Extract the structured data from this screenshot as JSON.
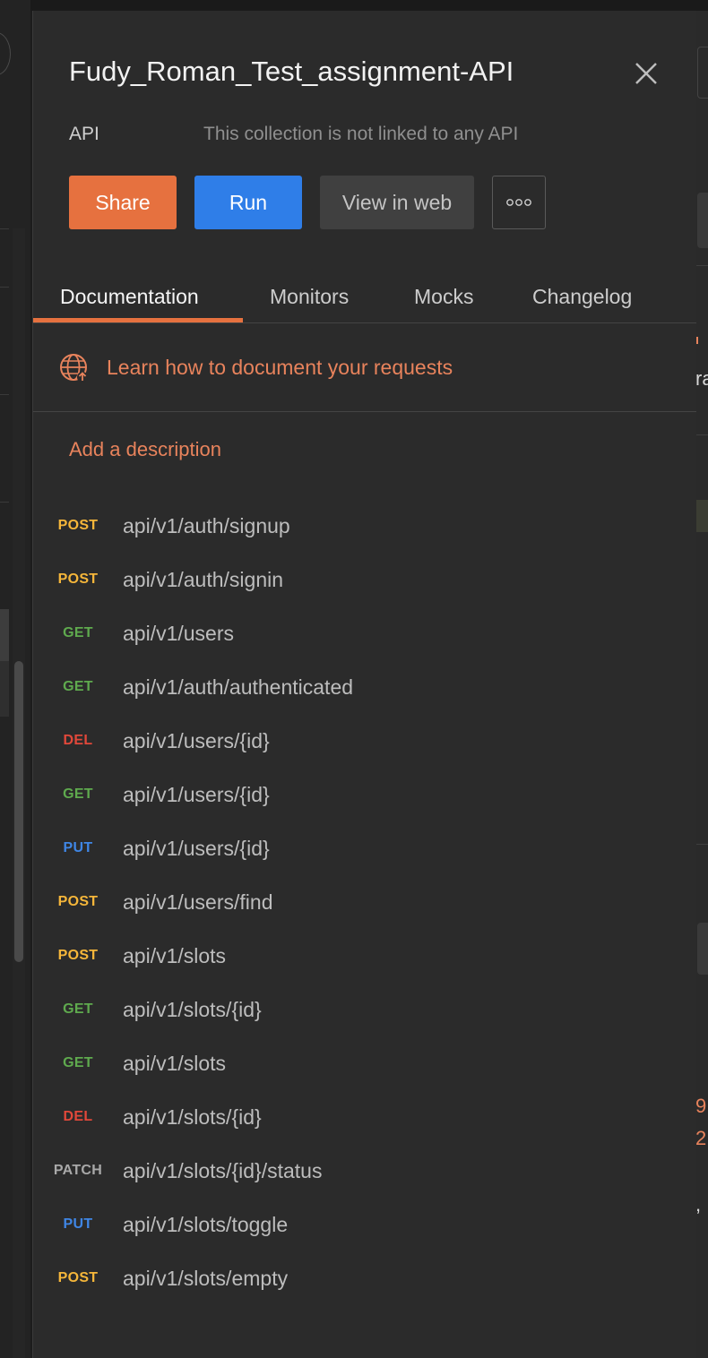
{
  "panel": {
    "title": "Fudy_Roman_Test_assignment-API",
    "api_label": "API",
    "api_status": "This collection is not linked to any API"
  },
  "buttons": {
    "share": "Share",
    "run": "Run",
    "view_in_web": "View in web",
    "more": "ooo"
  },
  "tabs": [
    "Documentation",
    "Monitors",
    "Mocks",
    "Changelog"
  ],
  "active_tab": "Documentation",
  "learn_link": "Learn how to document your requests",
  "add_description": "Add a description",
  "method_colors": {
    "POST": "#f5b63a",
    "GET": "#5faa4e",
    "DEL": "#e1483a",
    "PUT": "#3f86e5",
    "PATCH": "#a9a9a9"
  },
  "requests": [
    {
      "method": "POST",
      "path": "api/v1/auth/signup"
    },
    {
      "method": "POST",
      "path": "api/v1/auth/signin"
    },
    {
      "method": "GET",
      "path": "api/v1/users"
    },
    {
      "method": "GET",
      "path": "api/v1/auth/authenticated"
    },
    {
      "method": "DEL",
      "path": "api/v1/users/{id}"
    },
    {
      "method": "GET",
      "path": "api/v1/users/{id}"
    },
    {
      "method": "PUT",
      "path": "api/v1/users/{id}"
    },
    {
      "method": "POST",
      "path": "api/v1/users/find"
    },
    {
      "method": "POST",
      "path": "api/v1/slots"
    },
    {
      "method": "GET",
      "path": "api/v1/slots/{id}"
    },
    {
      "method": "GET",
      "path": "api/v1/slots"
    },
    {
      "method": "DEL",
      "path": "api/v1/slots/{id}"
    },
    {
      "method": "PATCH",
      "path": "api/v1/slots/{id}/status"
    },
    {
      "method": "PUT",
      "path": "api/v1/slots/toggle"
    },
    {
      "method": "POST",
      "path": "api/v1/slots/empty"
    }
  ],
  "background_fragments": {
    "right_top": "ra",
    "right_mid_1": "9",
    "right_mid_2": "2",
    "right_mid_3": ","
  },
  "colors": {
    "accent_orange": "#e6713f",
    "run_blue": "#2f7ee8",
    "panel_bg": "#2b2b2b"
  }
}
